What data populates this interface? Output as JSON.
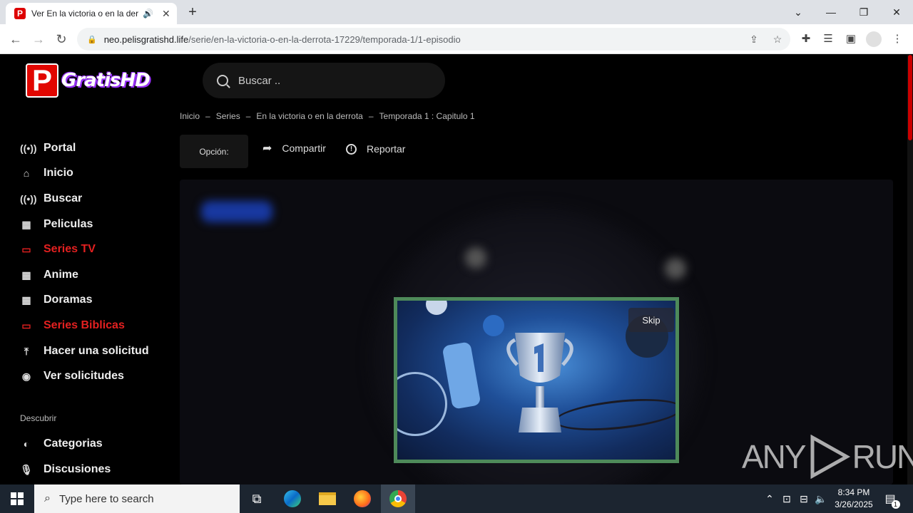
{
  "browser": {
    "tab_title": "Ver En la victoria o en la derrota",
    "tab_favicon_letter": "P",
    "url_host": "neo.pelisgratishd.life",
    "url_path": "/serie/en-la-victoria-o-en-la-derrota-17229/temporada-1/1-episodio",
    "icons": [
      "back-icon",
      "forward-icon",
      "reload-icon",
      "lock-icon",
      "share-icon",
      "star-icon",
      "extensions-icon",
      "media-icon",
      "sidepanel-icon",
      "profile-icon",
      "menu-icon"
    ]
  },
  "site": {
    "logo_letter": "P",
    "logo_text": "GratisHD",
    "search_placeholder": "Buscar ..",
    "breadcrumb": [
      "Inicio",
      "Series",
      "En la victoria o en la derrota",
      "Temporada 1 : Capitulo 1"
    ],
    "breadcrumb_sep": "–",
    "opcion_label": "Opción:",
    "share_label": "Compartir",
    "report_label": "Reportar",
    "sidebar": {
      "items": [
        {
          "label": "Portal",
          "icon": "broadcast-icon"
        },
        {
          "label": "Inicio",
          "icon": "home-icon"
        },
        {
          "label": "Buscar",
          "icon": "broadcast-icon"
        },
        {
          "label": "Peliculas",
          "icon": "film-icon"
        },
        {
          "label": "Series TV",
          "icon": "tv-icon",
          "highlight": true
        },
        {
          "label": "Anime",
          "icon": "film-icon"
        },
        {
          "label": "Doramas",
          "icon": "film-icon"
        },
        {
          "label": "Series Biblicas",
          "icon": "tv-icon",
          "highlight": true
        },
        {
          "label": "Hacer una solicitud",
          "icon": "upload-icon"
        },
        {
          "label": "Ver solicitudes",
          "icon": "eye-icon"
        }
      ],
      "section_heading": "Descubrir",
      "discover_items": [
        {
          "label": "Categorias",
          "icon": "half-circle-icon"
        },
        {
          "label": "Discusiones",
          "icon": "mic-icon"
        }
      ]
    },
    "ad": {
      "skip_label": "Skip"
    },
    "accent_color": "#e32020"
  },
  "watermark": {
    "left": "ANY",
    "right": "RUN"
  },
  "taskbar": {
    "search_placeholder": "Type here to search",
    "time": "8:34 PM",
    "date": "3/26/2025",
    "notification_count": "1"
  }
}
